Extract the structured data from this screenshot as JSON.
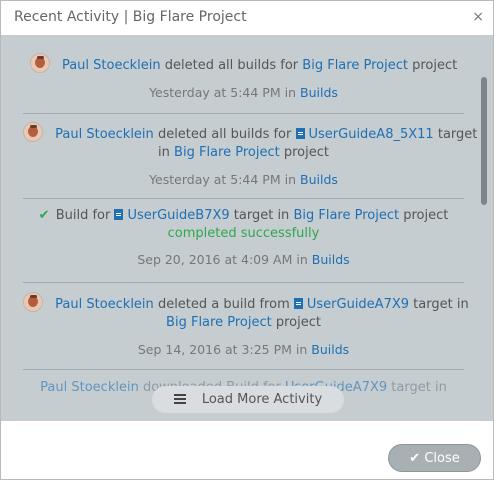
{
  "dialog": {
    "title": "Recent Activity | Big Flare Project",
    "close_glyph": "×"
  },
  "activities": [
    {
      "actor": "Paul Stoecklein",
      "action": "deleted all builds for",
      "project": "Big Flare Project",
      "suffix": "project",
      "when": "Yesterday at 5:44 PM",
      "in_word": "in",
      "category": "Builds"
    },
    {
      "actor": "Paul Stoecklein",
      "action": "deleted all builds for",
      "target": "UserGuideA8_5X11",
      "target_word": "target",
      "in_word": "in",
      "project": "Big Flare Project",
      "suffix": "project",
      "when": "Yesterday at 5:44 PM",
      "category": "Builds"
    },
    {
      "prefix": "Build for",
      "target": "UserGuideB7X9",
      "target_word": "target in",
      "project": "Big Flare Project",
      "suffix": "project",
      "status": "completed successfully",
      "when": "Sep 20, 2016 at 4:09 AM",
      "in_word": "in",
      "category": "Builds"
    },
    {
      "actor": "Paul Stoecklein",
      "action": "deleted a build from",
      "target": "UserGuideA7X9",
      "target_word": "target in",
      "project": "Big Flare Project",
      "suffix": "project",
      "when": "Sep 14, 2016 at 3:25 PM",
      "in_word": "in",
      "category": "Builds"
    }
  ],
  "partial_entry": {
    "actor": "Paul Stoecklein",
    "action": "downloaded Build for",
    "target": "UserGuideA7X9",
    "tail": "target in"
  },
  "load_more_label": "Load More Activity",
  "close_button_label": "Close"
}
